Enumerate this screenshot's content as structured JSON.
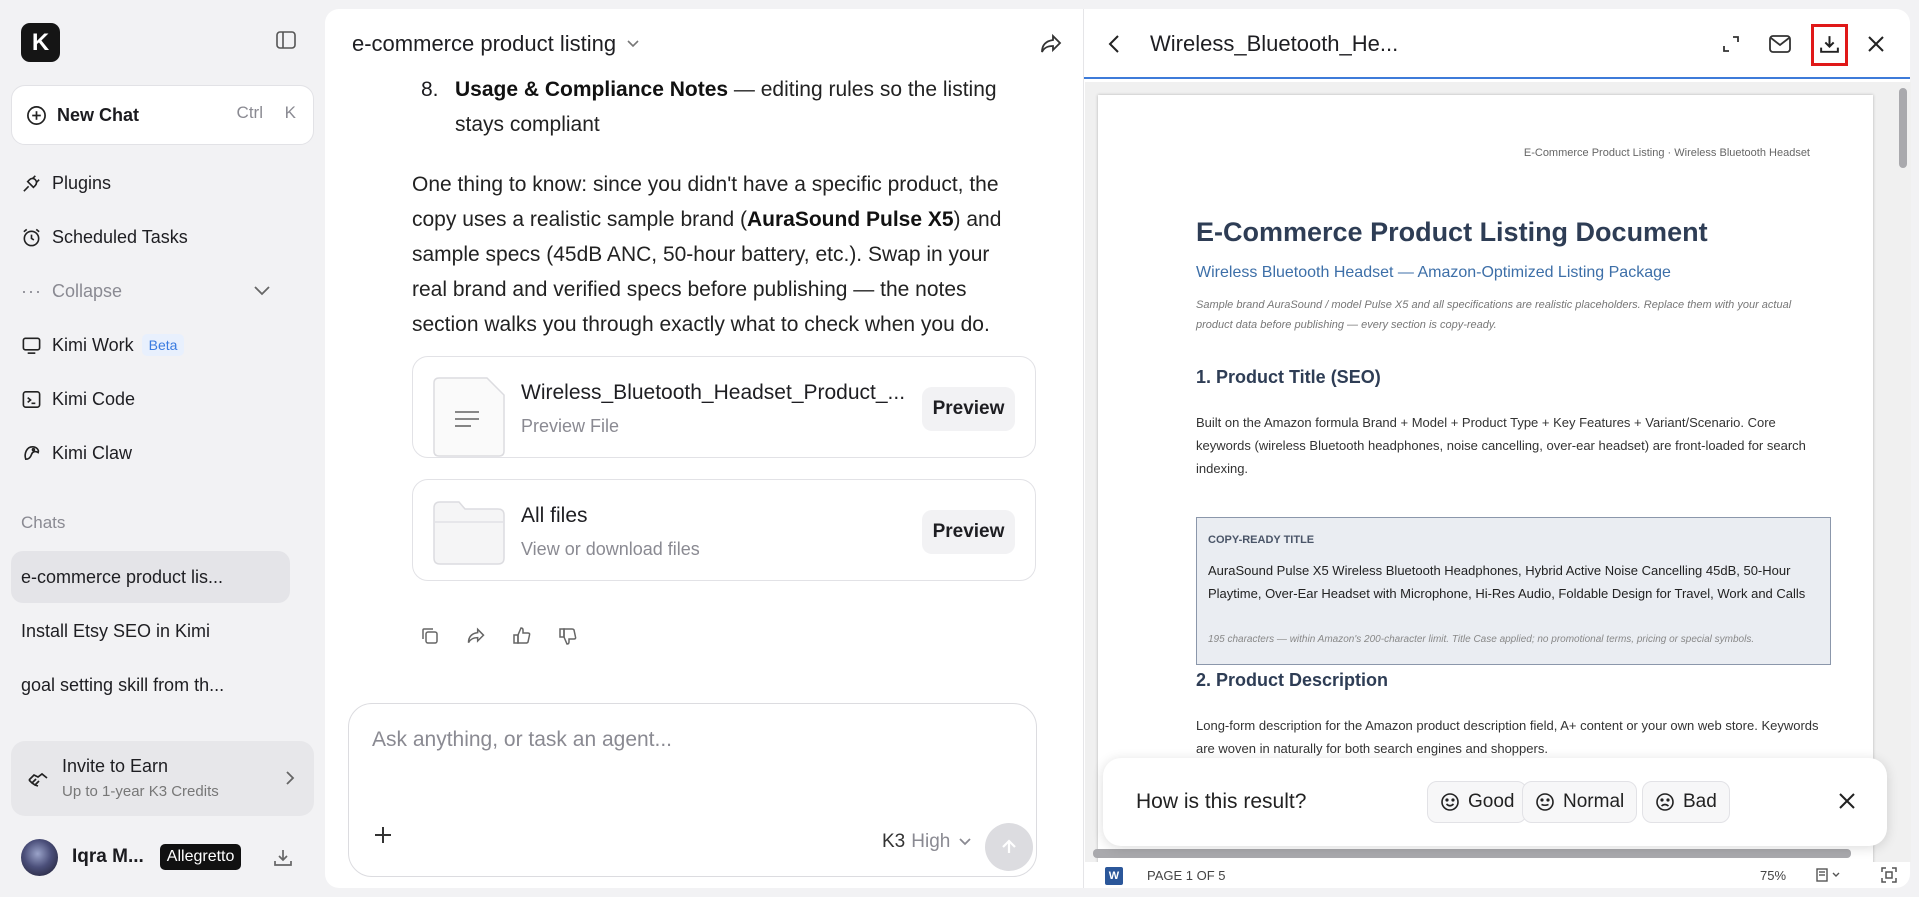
{
  "sidebar": {
    "logo_letter": "K",
    "new_chat": {
      "label": "New Chat",
      "kbd1": "Ctrl",
      "kbd2": "K"
    },
    "nav": [
      {
        "label": "Plugins",
        "icon": "plug-icon"
      },
      {
        "label": "Scheduled Tasks",
        "icon": "alarm-clock-icon"
      },
      {
        "label": "Collapse",
        "icon": "more-dots-icon"
      },
      {
        "label": "Kimi Work",
        "icon": "monitor-icon",
        "badge": "Beta"
      },
      {
        "label": "Kimi Code",
        "icon": "terminal-icon"
      },
      {
        "label": "Kimi Claw",
        "icon": "claw-icon"
      }
    ],
    "chats_label": "Chats",
    "chats": [
      "e-commerce product lis...",
      "Install Etsy SEO in Kimi",
      "goal setting skill from th..."
    ],
    "invite": {
      "title": "Invite to Earn",
      "subtitle": "Up to 1-year K3 Credits"
    },
    "user": {
      "name": "Iqra M...",
      "plan": "Allegretto"
    }
  },
  "chat": {
    "title": "e-commerce product listing",
    "list_item": {
      "number": "8.",
      "bold": "Usage & Compliance Notes",
      "rest": " — editing rules so the listing stays compliant"
    },
    "paragraph": {
      "p1": "One thing to know: since you didn't have a specific product, the copy uses a realistic sample brand (",
      "brand": "AuraSound Pulse X5",
      "p2": ") and sample specs (45dB ANC, 50-hour battery, etc.). Swap in your real brand and verified specs before publishing — the notes section walks you through exactly what to check when you do."
    },
    "files": [
      {
        "name": "Wireless_Bluetooth_Headset_Product_...",
        "sub": "Preview File",
        "button": "Preview"
      },
      {
        "name": "All files",
        "sub": "View or download files",
        "button": "Preview"
      }
    ],
    "composer": {
      "placeholder": "Ask anything, or task an agent...",
      "model": "K3",
      "mode": "High"
    }
  },
  "preview": {
    "title": "Wireless_Bluetooth_He...",
    "doc": {
      "header": "E-Commerce Product Listing · Wireless Bluetooth Headset",
      "title": "E-Commerce Product Listing Document",
      "subtitle": "Wireless Bluetooth Headset — Amazon-Optimized Listing Package",
      "note": "Sample brand AuraSound / model Pulse X5 and all specifications are realistic placeholders. Replace them with your actual product data before publishing — every section is copy-ready.",
      "s1_heading": "1. Product Title (SEO)",
      "s1_text": "Built on the Amazon formula Brand + Model + Product Type + Key Features + Variant/Scenario. Core keywords (wireless Bluetooth headphones, noise cancelling, over-ear headset) are front-loaded for search indexing.",
      "copy_caption": "COPY-READY TITLE",
      "copy_body": "AuraSound Pulse X5 Wireless Bluetooth Headphones, Hybrid Active Noise Cancelling 45dB, 50-Hour Playtime, Over-Ear Headset with Microphone, Hi-Res Audio, Foldable Design for Travel, Work and Calls",
      "copy_foot": "195 characters — within Amazon's 200-character limit. Title Case applied; no promotional terms, pricing or special symbols.",
      "s2_heading": "2. Product Description",
      "s2_text": "Long-form description for the Amazon product description field, A+ content or your own web store. Keywords are woven in naturally for both search engines and shoppers."
    },
    "rating": {
      "question": "How is this result?",
      "good": "Good",
      "normal": "Normal",
      "bad": "Bad"
    },
    "footer": {
      "page": "PAGE 1 OF 5",
      "zoom": "75%",
      "app_icon": "W"
    }
  },
  "colors": {
    "accent_blue": "#3d7bd9",
    "highlight_red": "#e01818",
    "doc_heading": "#2e3d55"
  }
}
